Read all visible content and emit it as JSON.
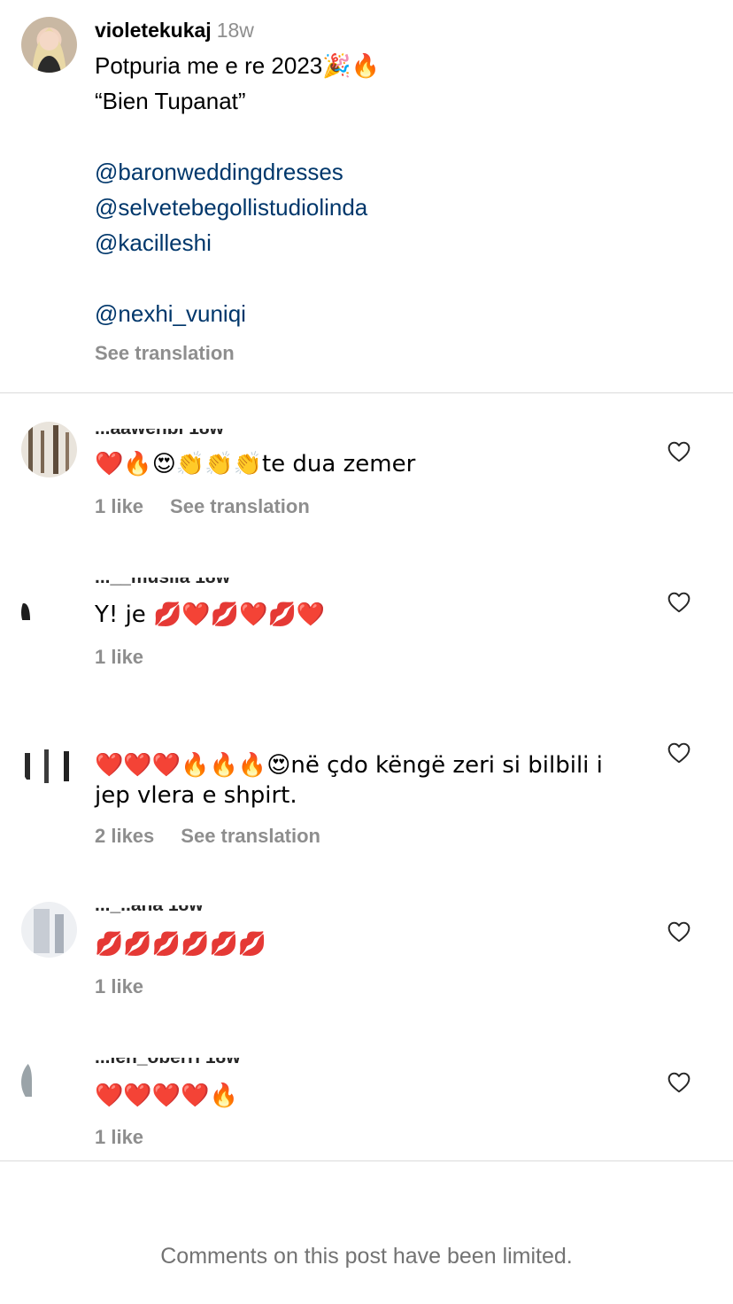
{
  "caption": {
    "username": "violetekukaj",
    "time": "18w",
    "lines": [
      {
        "text": "Potpuria me e re 2023🎉🔥",
        "mention": false
      },
      {
        "text": "“Bien Tupanat”",
        "mention": false
      },
      {
        "text": "",
        "mention": false
      },
      {
        "text": "@baronweddingdresses",
        "mention": true
      },
      {
        "text": "@selvetebegollistudiolinda",
        "mention": true
      },
      {
        "text": "@kacilleshi",
        "mention": true
      },
      {
        "text": "",
        "mention": false
      },
      {
        "text": "@nexhi_vuniqi",
        "mention": true
      }
    ],
    "see_translation": "See translation"
  },
  "comments": [
    {
      "username_partial": "...aawenbi 18w",
      "text": "❤️🔥😍👏👏👏te dua zemer",
      "likes": "1 like",
      "see_translation": "See translation"
    },
    {
      "username_partial": "...__musiia 18w",
      "text": "Y! je 💋❤️💋❤️💋❤️",
      "likes": "1 like",
      "see_translation": ""
    },
    {
      "username_partial": "",
      "text": "❤️❤️❤️🔥🔥🔥😍në çdo këngë zeri si bilbili i jep vlera e shpirt.",
      "likes": "2 likes",
      "see_translation": "See translation"
    },
    {
      "username_partial": "..._..ana 18w",
      "text": "💋💋💋💋💋💋",
      "likes": "1 like",
      "see_translation": ""
    },
    {
      "username_partial": "...ien_oberri 18w",
      "text": "❤️❤️❤️❤️🔥",
      "likes": "1 like",
      "see_translation": ""
    }
  ],
  "footer": {
    "limited_notice": "Comments on this post have been limited."
  },
  "icons": {
    "like": "heart-outline-icon"
  },
  "colors": {
    "mention": "#00376b",
    "secondary": "#8e8e8e",
    "divider": "#dbdbdb"
  }
}
